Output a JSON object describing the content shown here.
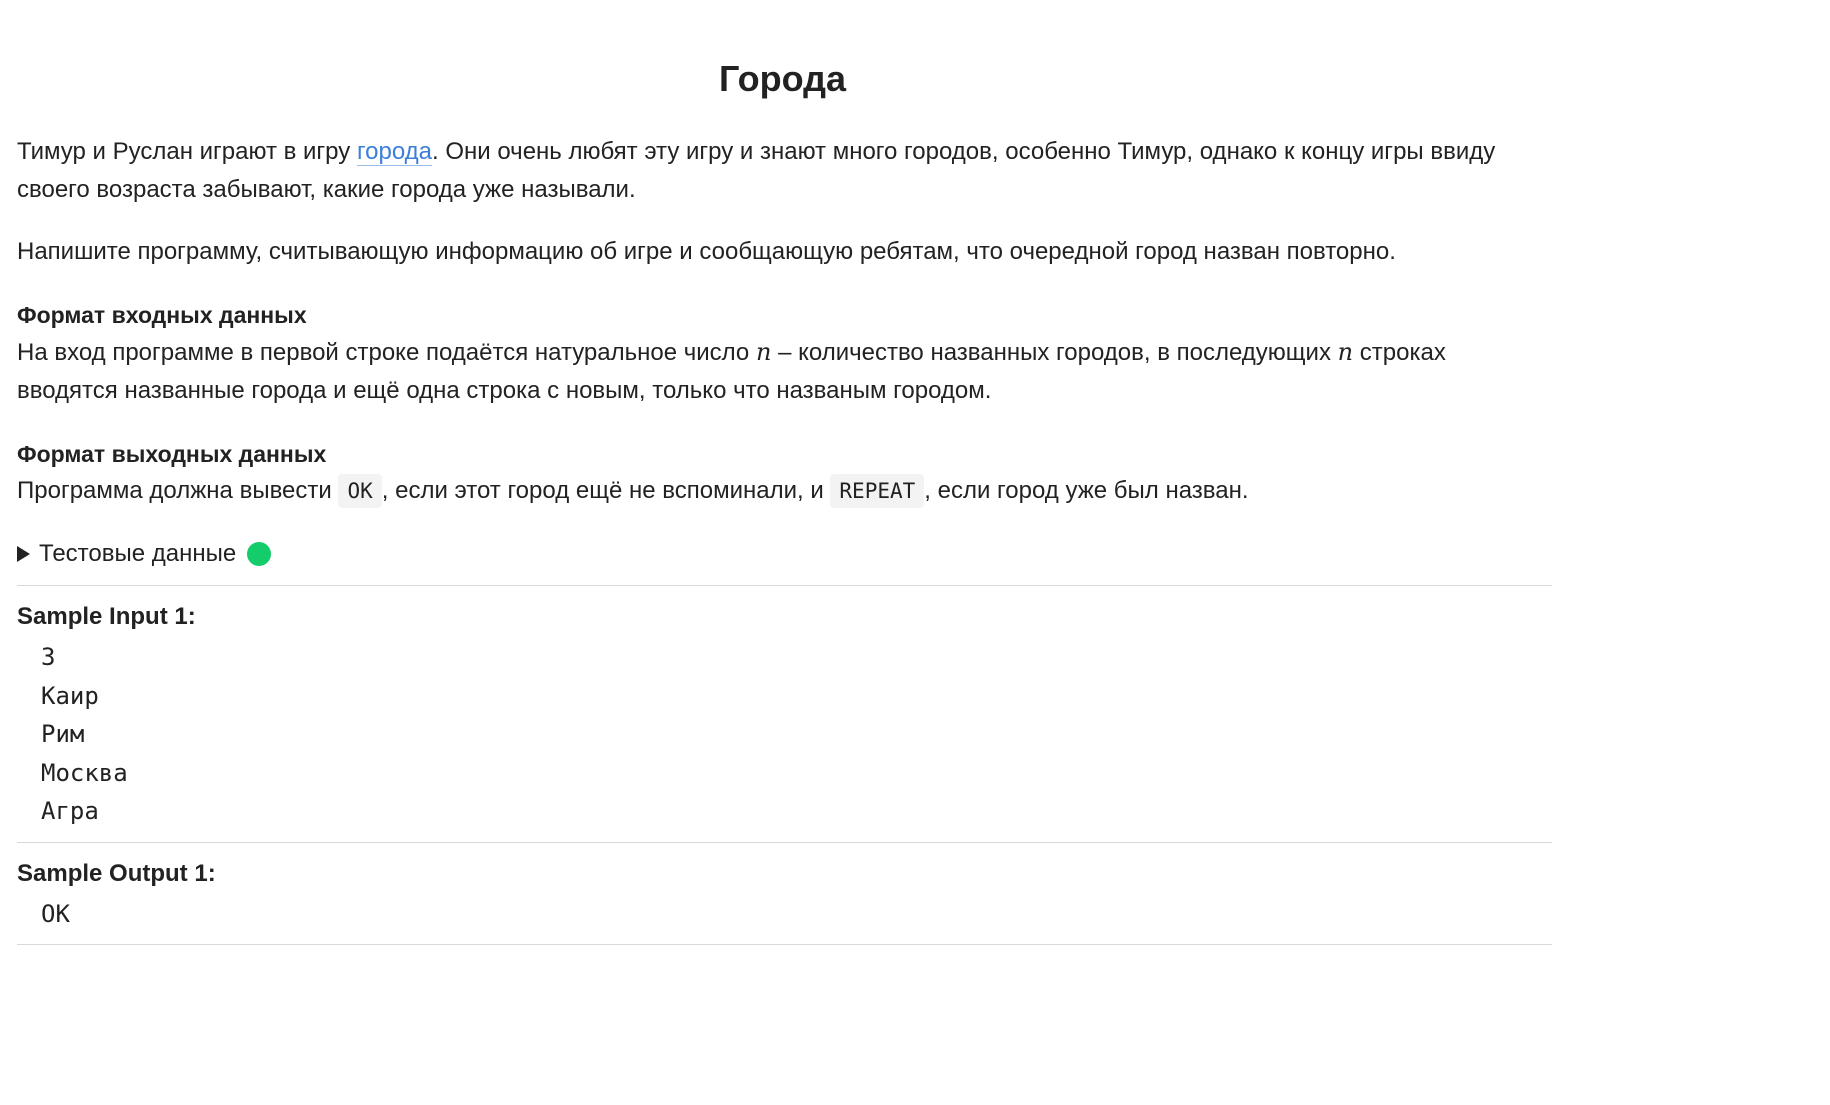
{
  "title": "Города",
  "intro": {
    "before_link": "Тимур и Руслан играют в игру ",
    "link_text": "города",
    "after_link": ". Они очень любят эту игру и знают много городов, особенно Тимур, однако к концу игры ввиду своего возраста забывают, какие города уже называли."
  },
  "task": "Напишите программу, считывающую информацию об игре и сообщающую ребятам, что очередной город назван повторно.",
  "input_format": {
    "heading": "Формат входных данных",
    "text_1": "На вход программе в первой строке подаётся натуральное число ",
    "var_1": "n",
    "text_2": " – количество названных городов, в последующих ",
    "var_2": "n",
    "text_3": " строках вводятся названные города и ещё одна строка с новым, только что названым городом."
  },
  "output_format": {
    "heading": "Формат выходных данных",
    "text_1": "Программа должна вывести ",
    "code_1": "OK",
    "text_2": ", если этот город ещё не вспоминали, и ",
    "code_2": "REPEAT",
    "text_3": ", если город уже был назван."
  },
  "test_data": {
    "label": "Тестовые данные",
    "status_color": "#15cc6b"
  },
  "sample_input": {
    "heading": "Sample Input 1:",
    "lines": [
      "3",
      "Каир",
      "Рим",
      "Москва",
      "Агра"
    ]
  },
  "sample_output": {
    "heading": "Sample Output 1:",
    "lines": [
      "OK"
    ]
  },
  "colors": {
    "link": "#3b7fd9",
    "text": "#222222",
    "divider": "#d9d9d9",
    "code_bg": "#f3f3f3"
  }
}
